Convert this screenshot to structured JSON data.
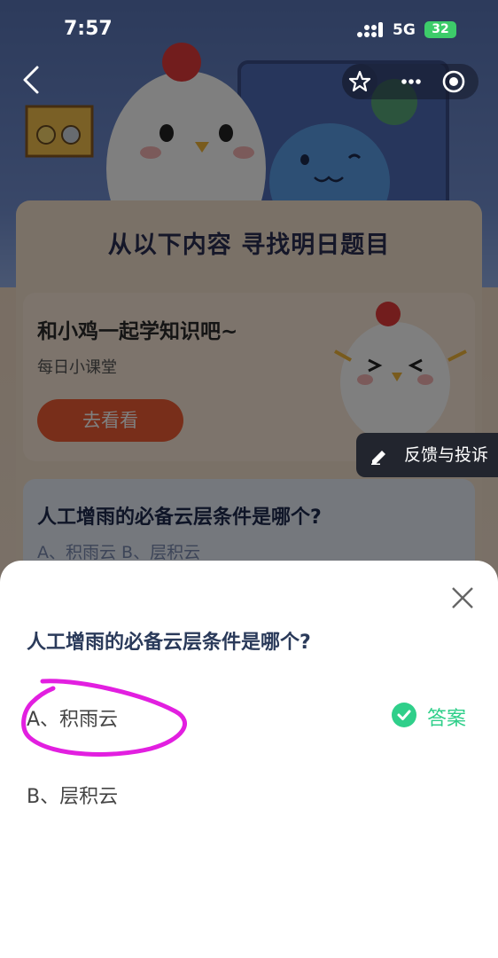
{
  "status_bar": {
    "time": "7:57",
    "network": "5G",
    "battery": "32"
  },
  "page": {
    "heading": "从以下内容  寻找明日题目"
  },
  "lesson_card": {
    "title": "和小鸡一起学知识吧~",
    "subtitle": "每日小课堂",
    "button_label": "去看看"
  },
  "feedback": {
    "label": "反馈与投诉"
  },
  "background_question": {
    "text": "人工增雨的必备云层条件是哪个?",
    "options": "A、积雨云    B、层积云"
  },
  "sheet": {
    "question": "人工增雨的必备云层条件是哪个?",
    "options": [
      {
        "label": "A、积雨云",
        "is_answer": true
      },
      {
        "label": "B、层积云",
        "is_answer": false
      }
    ],
    "answer_label": "答案"
  },
  "colors": {
    "accent_green": "#2fcf8a",
    "button_orange": "#f05d34",
    "marker_magenta": "#e21fe0"
  },
  "icons": [
    "back-icon",
    "star-icon",
    "more-icon",
    "target-icon",
    "edit-icon",
    "close-icon",
    "check-icon"
  ]
}
